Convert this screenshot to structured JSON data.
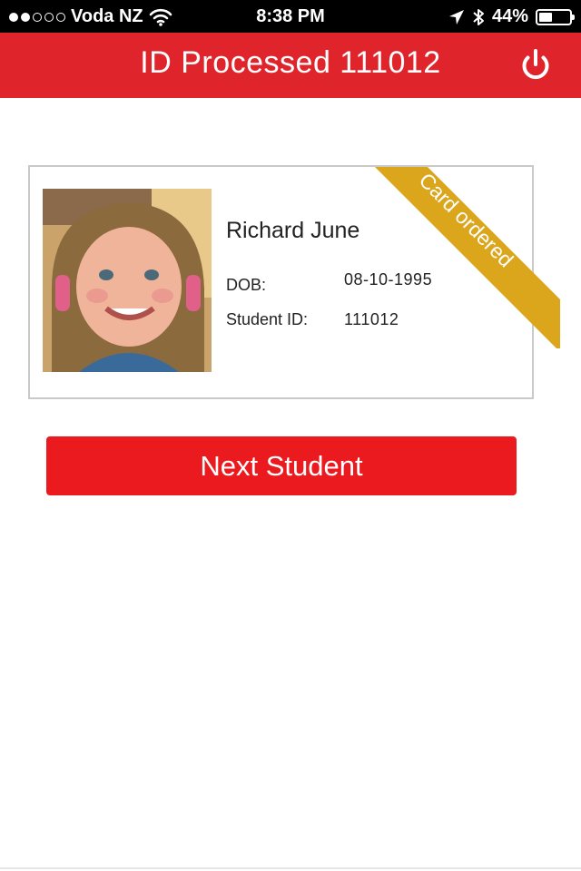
{
  "status_bar": {
    "carrier": "Voda NZ",
    "time": "8:38 PM",
    "battery_percent": "44%",
    "battery_level": 0.44,
    "signal_filled": 2,
    "signal_total": 5
  },
  "header": {
    "title": "ID Processed 111012",
    "power_icon": "power-icon"
  },
  "student_card": {
    "name": "Richard June",
    "dob_label": "DOB:",
    "dob_value": "08-10-1995",
    "student_id_label": "Student ID:",
    "student_id_value": "111012",
    "ribbon_text": "Card ordered"
  },
  "actions": {
    "next_student_label": "Next Student"
  },
  "colors": {
    "header_red": "#e0242b",
    "button_red": "#ea1a1f",
    "ribbon_gold": "#dba51c"
  }
}
